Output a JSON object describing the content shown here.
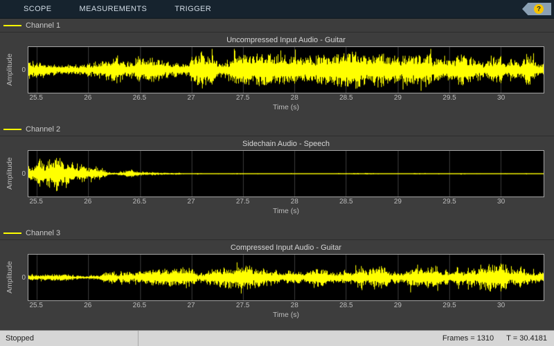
{
  "toolbar": {
    "tabs": [
      "SCOPE",
      "MEASUREMENTS",
      "TRIGGER"
    ],
    "help_icon": "?"
  },
  "time_axis": {
    "start": 25.4181,
    "end": 30.4181,
    "ticks": [
      "25.5",
      "26",
      "26.5",
      "27",
      "27.5",
      "28",
      "28.5",
      "29",
      "29.5",
      "30"
    ],
    "xlabel": "Time (s)"
  },
  "channels": [
    {
      "legend": "Channel 1",
      "title": "Uncompressed Input Audio - Guitar",
      "ylabel": "Amplitude",
      "ytick": "0",
      "waveform": {
        "seed": 101,
        "color": "#ffff00",
        "envelope": [
          [
            25.4,
            0.55
          ],
          [
            25.7,
            0.5
          ],
          [
            26.0,
            0.62
          ],
          [
            26.2,
            0.85
          ],
          [
            26.5,
            0.7
          ],
          [
            26.8,
            0.55
          ],
          [
            27.1,
            0.75
          ],
          [
            27.4,
            0.6
          ],
          [
            27.7,
            0.65
          ],
          [
            28.0,
            0.55
          ],
          [
            28.3,
            0.6
          ],
          [
            28.6,
            0.8
          ],
          [
            28.9,
            0.65
          ],
          [
            29.2,
            0.6
          ],
          [
            29.5,
            0.7
          ],
          [
            29.8,
            0.6
          ],
          [
            30.1,
            0.68
          ],
          [
            30.45,
            0.6
          ]
        ]
      }
    },
    {
      "legend": "Channel 2",
      "title": "Sidechain Audio - Speech",
      "ylabel": "Amplitude",
      "ytick": "0",
      "waveform": {
        "seed": 202,
        "color": "#ffff00",
        "envelope": [
          [
            25.4,
            0.45
          ],
          [
            25.5,
            0.8
          ],
          [
            25.6,
            0.9
          ],
          [
            25.75,
            0.55
          ],
          [
            25.9,
            0.35
          ],
          [
            26.0,
            0.5
          ],
          [
            26.1,
            0.2
          ],
          [
            26.25,
            0.12
          ],
          [
            26.4,
            0.18
          ],
          [
            26.55,
            0.08
          ],
          [
            26.8,
            0.04
          ],
          [
            27.2,
            0.03
          ],
          [
            30.45,
            0.03
          ]
        ]
      }
    },
    {
      "legend": "Channel 3",
      "title": "Compressed Input Audio - Guitar",
      "ylabel": "Amplitude",
      "ytick": "0",
      "waveform": {
        "seed": 303,
        "color": "#ffff00",
        "envelope": [
          [
            25.4,
            0.12
          ],
          [
            25.8,
            0.14
          ],
          [
            26.1,
            0.18
          ],
          [
            26.35,
            0.4
          ],
          [
            26.6,
            0.32
          ],
          [
            26.9,
            0.38
          ],
          [
            27.2,
            0.5
          ],
          [
            27.5,
            0.55
          ],
          [
            27.8,
            0.5
          ],
          [
            28.1,
            0.55
          ],
          [
            28.4,
            0.62
          ],
          [
            28.7,
            0.5
          ],
          [
            29.0,
            0.55
          ],
          [
            29.3,
            0.6
          ],
          [
            29.6,
            0.65
          ],
          [
            29.9,
            0.55
          ],
          [
            30.2,
            0.58
          ],
          [
            30.45,
            0.5
          ]
        ]
      }
    }
  ],
  "statusbar": {
    "state": "Stopped",
    "frames": "Frames = 1310",
    "time": "T = 30.4181"
  },
  "colors": {
    "waveform": "#ffff00",
    "toolbar_bg": "#16232e",
    "plot_bg": "#000000",
    "figure_bg": "#3d3d3d",
    "grid": "#3c3c3c",
    "status_bg": "#d6d6d6"
  }
}
